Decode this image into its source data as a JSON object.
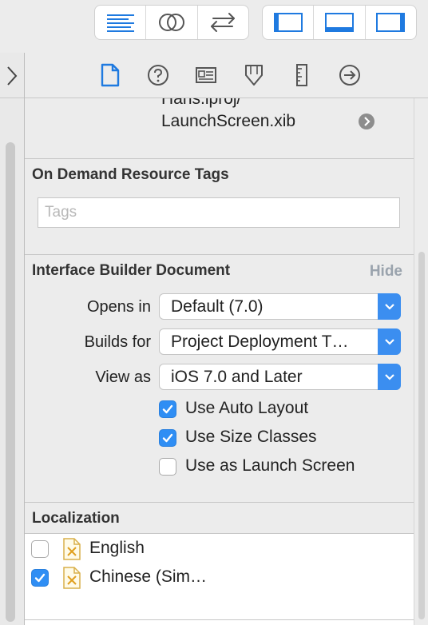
{
  "toolbar": {
    "group1": [
      "text-editor-icon",
      "assistant-editor-icon",
      "version-editor-icon"
    ],
    "group2": [
      "navigator-panel-icon",
      "debug-panel-icon",
      "utilities-panel-icon"
    ]
  },
  "inspector_tabs": [
    "file-icon",
    "help-icon",
    "identity-icon",
    "attributes-icon",
    "size-icon",
    "connections-icon"
  ],
  "file": {
    "path_line1": "Hans.lproj/",
    "path_line2": "LaunchScreen.xib"
  },
  "on_demand": {
    "title": "On Demand Resource Tags",
    "tags_placeholder": "Tags"
  },
  "ib_document": {
    "title": "Interface Builder Document",
    "hide_label": "Hide",
    "opens_in_label": "Opens in",
    "opens_in_value": "Default (7.0)",
    "builds_for_label": "Builds for",
    "builds_for_value": "Project Deployment T…",
    "view_as_label": "View as",
    "view_as_value": "iOS 7.0 and Later",
    "auto_layout_label": "Use Auto Layout",
    "auto_layout_checked": true,
    "size_classes_label": "Use Size Classes",
    "size_classes_checked": true,
    "launch_screen_label": "Use as Launch Screen",
    "launch_screen_checked": false
  },
  "localization": {
    "title": "Localization",
    "items": [
      {
        "label": "English",
        "checked": false
      },
      {
        "label": "Chinese (Sim…",
        "checked": true
      }
    ]
  },
  "colors": {
    "accent": "#3b8ef0",
    "checkbox_blue": "#2f8ef4",
    "icon_blue": "#1f7ae0",
    "icon_gray": "#555555"
  }
}
